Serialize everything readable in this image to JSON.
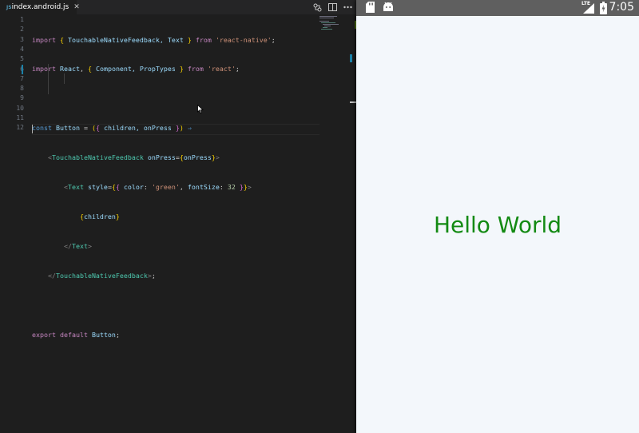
{
  "editor": {
    "tab": {
      "file_icon_label": "JS",
      "file_name": "index.android.js",
      "close_glyph": "✕"
    },
    "toolbar_icons": [
      "compare-icon",
      "split-editor-icon",
      "more-actions-icon"
    ],
    "line_numbers": [
      "1",
      "2",
      "3",
      "4",
      "5",
      "6",
      "7",
      "8",
      "9",
      "10",
      "11",
      "12"
    ],
    "colors": {
      "background": "#1e1e1e",
      "keyword": "#c586c0",
      "component": "#4ec9b0",
      "string": "#ce9178",
      "variable": "#9cdcfe"
    }
  },
  "code": {
    "l1": {
      "import": "import",
      "open": "{",
      "names": " TouchableNativeFeedback, Text ",
      "close": "}",
      "from": "from",
      "module": "'react-native'",
      "end": ";"
    },
    "l2": {
      "import": "import",
      "react": "React",
      "comma": ", ",
      "open": "{",
      "names": " Component, PropTypes ",
      "close": "}",
      "from": "from",
      "module": "'react'",
      "end": ";"
    },
    "l4": {
      "const": "const",
      "name": "Button",
      "eq": " = ",
      "p1": "(",
      "b1": "{",
      "args": " children, onPress ",
      "b2": "}",
      "p2": ")",
      "arrow": "⇒"
    },
    "l5": {
      "lt": "<",
      "tag": "TouchableNativeFeedback",
      "attr": "onPress",
      "eq": "=",
      "open": "{",
      "val": "onPress",
      "close": "}",
      "gt": ">"
    },
    "l6": {
      "lt": "<",
      "tag": "Text",
      "attr": "style",
      "eq": "=",
      "o1": "{",
      "o2": "{",
      "key": " color",
      "colon": ": ",
      "str": "'green'",
      "comma": ", ",
      "key2": "fontSize",
      "colon2": ": ",
      "num": "32",
      "c2": " }",
      "c1": "}",
      "gt": ">"
    },
    "l7": {
      "open": "{",
      "val": "children",
      "close": "}"
    },
    "l8": {
      "lt": "</",
      "tag": "Text",
      "gt": ">"
    },
    "l9": {
      "lt": "</",
      "tag": "TouchableNativeFeedback",
      "gt": ">",
      "end": ";"
    },
    "l11": {
      "export": "export",
      "default": "default",
      "name": "Button",
      "end": ";"
    }
  },
  "android": {
    "status": {
      "time": "7:05",
      "network": "LTE",
      "icons": [
        "sd-card-icon",
        "android-icon",
        "signal-icon",
        "battery-icon"
      ]
    },
    "content": {
      "text": "Hello World",
      "text_color": "#138a13"
    }
  }
}
